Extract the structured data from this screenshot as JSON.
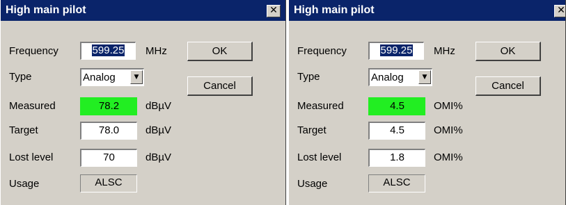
{
  "dialogs": [
    {
      "title": "High main pilot",
      "close_glyph": "✕",
      "frequency": {
        "label": "Frequency",
        "value": "599.25",
        "unit": "MHz"
      },
      "type": {
        "label": "Type",
        "value": "Analog",
        "dropdown_glyph": "▼"
      },
      "measured": {
        "label": "Measured",
        "value": "78.2",
        "unit": "dBµV",
        "color": "#22ee22"
      },
      "target": {
        "label": "Target",
        "value": "78.0",
        "unit": "dBµV"
      },
      "lost_level": {
        "label": "Lost level",
        "value": "70",
        "unit": "dBµV"
      },
      "usage": {
        "label": "Usage",
        "value": "ALSC"
      },
      "ok_label": "OK",
      "cancel_label": "Cancel"
    },
    {
      "title": "High main pilot",
      "close_glyph": "✕",
      "frequency": {
        "label": "Frequency",
        "value": "599.25",
        "unit": "MHz"
      },
      "type": {
        "label": "Type",
        "value": "Analog",
        "dropdown_glyph": "▼"
      },
      "measured": {
        "label": "Measured",
        "value": "4.5",
        "unit": "OMI%",
        "color": "#22ee22"
      },
      "target": {
        "label": "Target",
        "value": "4.5",
        "unit": "OMI%"
      },
      "lost_level": {
        "label": "Lost level",
        "value": "1.8",
        "unit": "OMI%"
      },
      "usage": {
        "label": "Usage",
        "value": "ALSC"
      },
      "ok_label": "OK",
      "cancel_label": "Cancel"
    }
  ],
  "colors": {
    "titlebar": "#0a246a",
    "dialog_bg": "#d4d0c8",
    "measured_bg": "#22ee22"
  },
  "icons": {
    "close": "close-icon",
    "dropdown": "chevron-down-icon"
  }
}
